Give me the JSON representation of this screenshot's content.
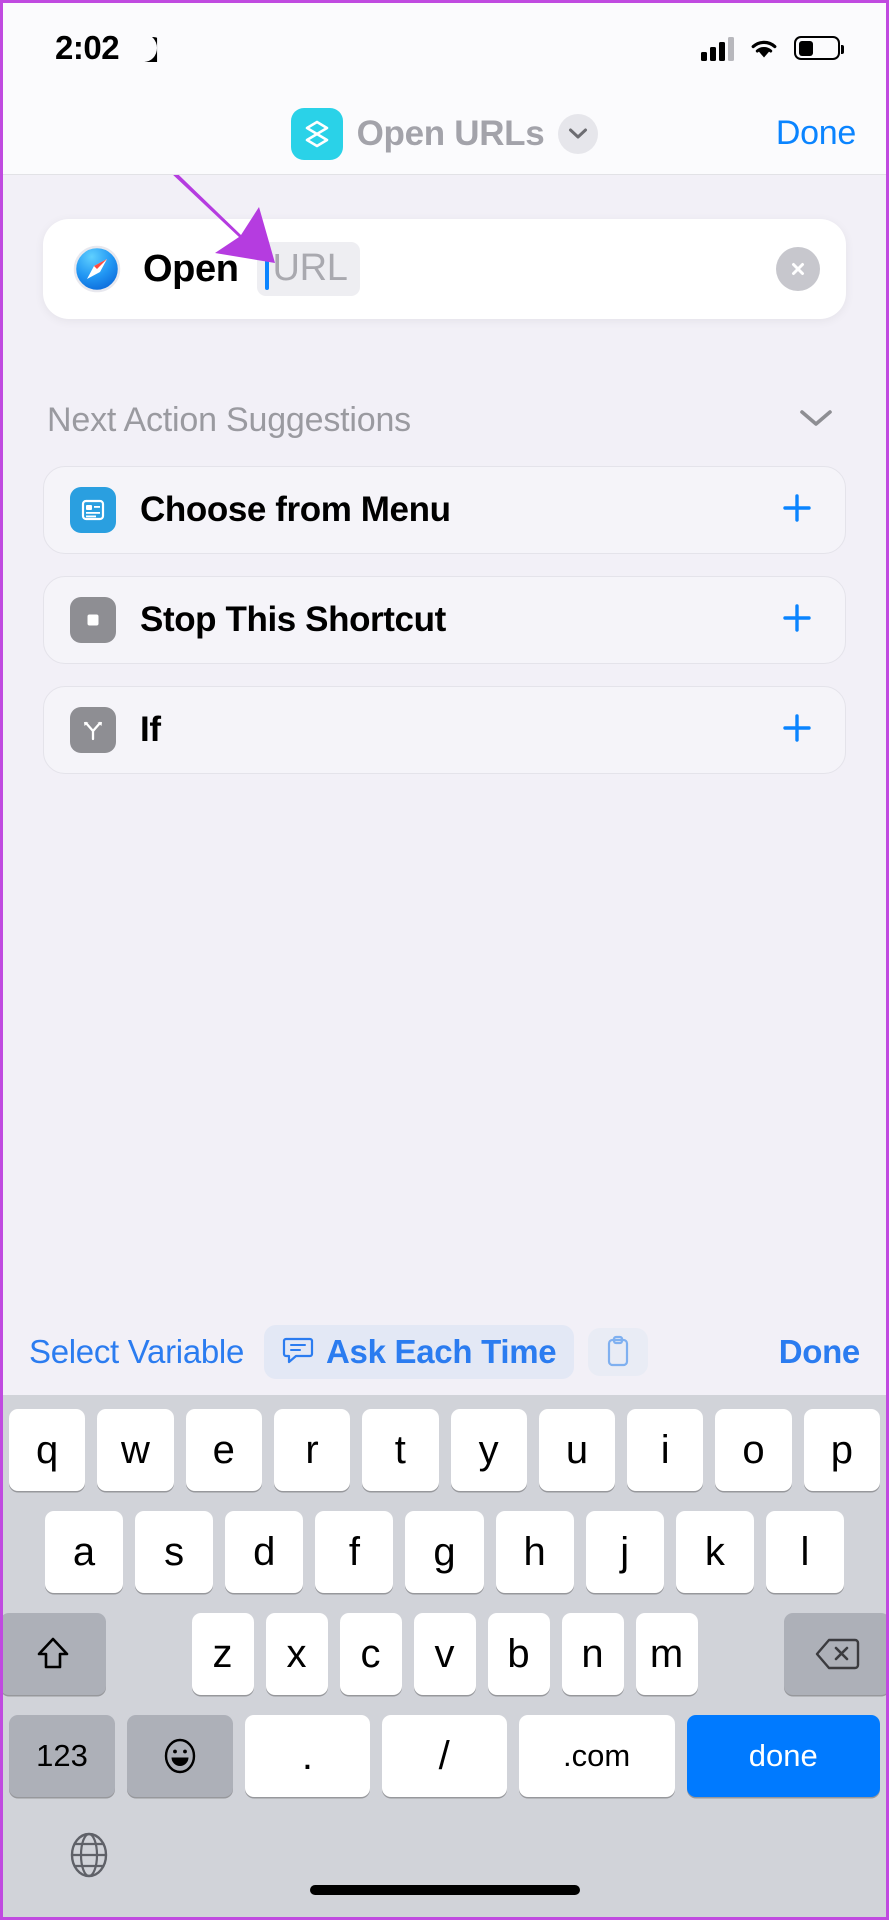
{
  "status_bar": {
    "time": "2:02",
    "moon_icon": "crescent-moon-icon",
    "signal_icon": "cellular-signal-icon",
    "wifi_icon": "wifi-icon",
    "battery_icon": "battery-icon"
  },
  "nav_bar": {
    "app_icon": "shortcuts-icon",
    "title": "Open URLs",
    "chevron_icon": "chevron-down-icon",
    "done_label": "Done"
  },
  "action": {
    "app_icon": "safari-compass-icon",
    "verb": "Open",
    "field_placeholder": "URL",
    "field_value": "",
    "clear_icon": "close-circle-icon"
  },
  "annotation": {
    "arrow_color": "#b53ce0",
    "points_to": "url-input-field"
  },
  "suggestions_section": {
    "title": "Next Action Suggestions",
    "collapse_icon": "chevron-down-icon",
    "items": [
      {
        "label": "Choose from Menu",
        "icon": "menu-list-icon",
        "icon_color": "#2a9fe0",
        "add_icon": "plus-icon"
      },
      {
        "label": "Stop This Shortcut",
        "icon": "stop-square-icon",
        "icon_color": "#8e8e93",
        "add_icon": "plus-icon"
      },
      {
        "label": "If",
        "icon": "branch-icon",
        "icon_color": "#8e8e93",
        "add_icon": "plus-icon"
      }
    ]
  },
  "accessory_bar": {
    "select_variable_label": "Select Variable",
    "ask_each_time_label": "Ask Each Time",
    "ask_each_time_icon": "speech-bubble-icon",
    "clipboard_icon": "clipboard-icon",
    "done_label": "Done"
  },
  "keyboard": {
    "row1": [
      "q",
      "w",
      "e",
      "r",
      "t",
      "y",
      "u",
      "i",
      "o",
      "p"
    ],
    "row2": [
      "a",
      "s",
      "d",
      "f",
      "g",
      "h",
      "j",
      "k",
      "l"
    ],
    "row3_shift_icon": "shift-up-arrow-icon",
    "row3": [
      "z",
      "x",
      "c",
      "v",
      "b",
      "n",
      "m"
    ],
    "row3_delete_icon": "delete-backspace-icon",
    "numbers_label": "123",
    "emoji_icon": "emoji-smiley-icon",
    "period_label": ".",
    "slash_label": "/",
    "dotcom_label": ".com",
    "done_label": "done",
    "globe_icon": "globe-icon"
  },
  "colors": {
    "accent_blue": "#0a84ff",
    "keyboard_blue": "#007aff",
    "shortcut_teal": "#2ad2e8",
    "annotation_purple": "#b53ce0",
    "background": "#f2f0f7"
  }
}
